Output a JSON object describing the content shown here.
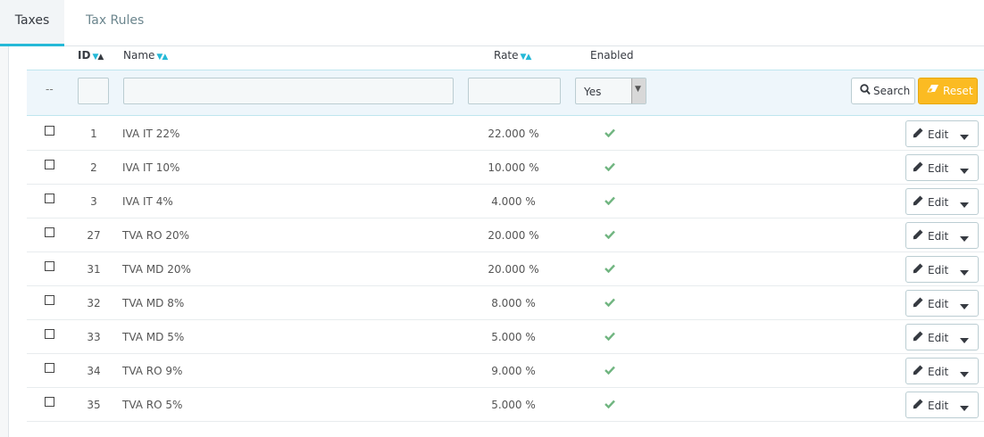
{
  "tabs": [
    {
      "label": "Taxes",
      "active": true
    },
    {
      "label": "Tax Rules",
      "active": false
    }
  ],
  "table": {
    "columns": {
      "id": "ID",
      "name": "Name",
      "rate": "Rate",
      "enabled": "Enabled"
    },
    "filters": {
      "placeholder_dashes": "--",
      "id": "",
      "name": "",
      "rate": "",
      "enabled_selected": "Yes",
      "search_label": "Search",
      "reset_label": "Reset"
    },
    "rows": [
      {
        "id": "1",
        "name": "IVA IT 22%",
        "rate": "22.000 %",
        "enabled": true,
        "action": "Edit"
      },
      {
        "id": "2",
        "name": "IVA IT 10%",
        "rate": "10.000 %",
        "enabled": true,
        "action": "Edit"
      },
      {
        "id": "3",
        "name": "IVA IT 4%",
        "rate": "4.000 %",
        "enabled": true,
        "action": "Edit"
      },
      {
        "id": "27",
        "name": "TVA RO 20%",
        "rate": "20.000 %",
        "enabled": true,
        "action": "Edit"
      },
      {
        "id": "31",
        "name": "TVA MD 20%",
        "rate": "20.000 %",
        "enabled": true,
        "action": "Edit"
      },
      {
        "id": "32",
        "name": "TVA MD 8%",
        "rate": "8.000 %",
        "enabled": true,
        "action": "Edit"
      },
      {
        "id": "33",
        "name": "TVA MD 5%",
        "rate": "5.000 %",
        "enabled": true,
        "action": "Edit"
      },
      {
        "id": "34",
        "name": "TVA RO 9%",
        "rate": "9.000 %",
        "enabled": true,
        "action": "Edit"
      },
      {
        "id": "35",
        "name": "TVA RO 5%",
        "rate": "5.000 %",
        "enabled": true,
        "action": "Edit"
      }
    ]
  },
  "colors": {
    "accent": "#25b9d7",
    "reset": "#fbbb22",
    "enabled_check": "#70b580"
  }
}
